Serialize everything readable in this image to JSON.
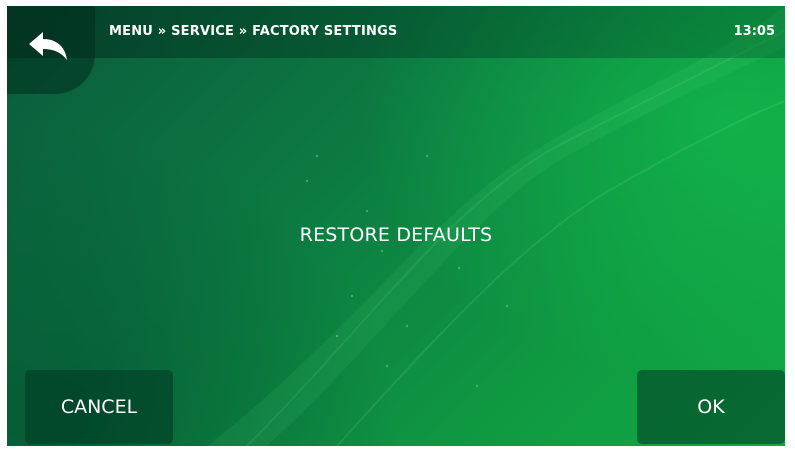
{
  "header": {
    "breadcrumb": "MENU » SERVICE » FACTORY SETTINGS",
    "time": "13:05",
    "back_icon": "back-arrow-icon"
  },
  "dialog": {
    "message": "RESTORE DEFAULTS",
    "cancel_label": "CANCEL",
    "ok_label": "OK"
  },
  "colors": {
    "background_dark": "#0a5a3c",
    "background_light": "#12a845",
    "text": "#ffffff"
  }
}
